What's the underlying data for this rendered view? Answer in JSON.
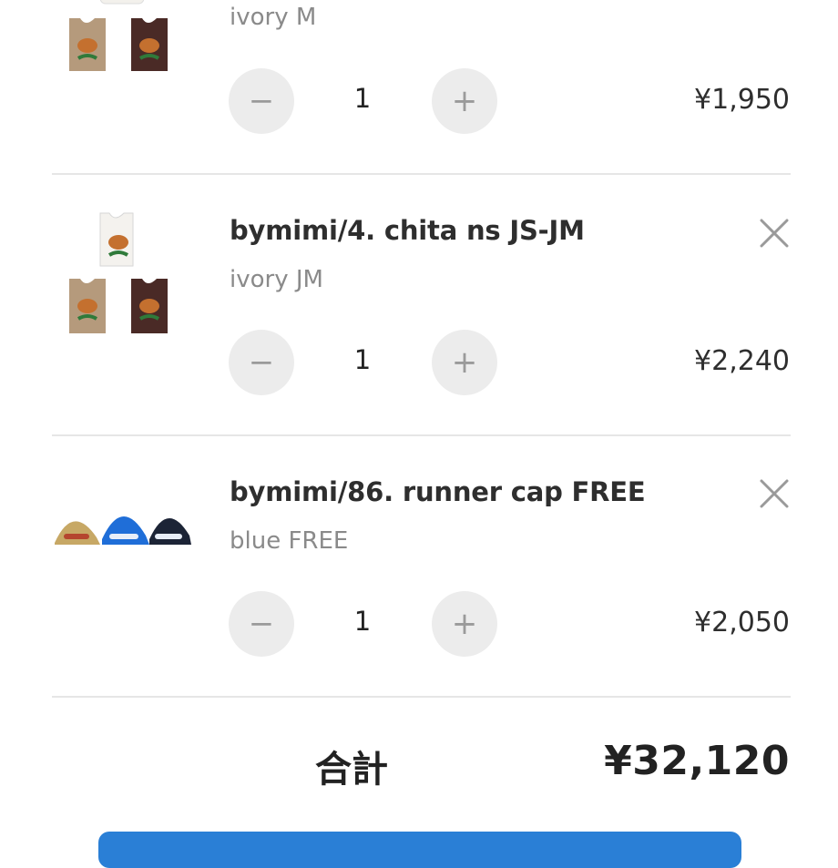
{
  "cart": {
    "items": [
      {
        "name": "",
        "variant": "ivory M",
        "quantity": "1",
        "price": "¥1,950",
        "minus_symbol": "−",
        "plus_symbol": "+",
        "thumbnail_icon": "tank-top-cheetah-thumbnail"
      },
      {
        "name": "bymimi/4. chita ns JS-JM",
        "variant": "ivory JM",
        "quantity": "1",
        "price": "¥2,240",
        "minus_symbol": "−",
        "plus_symbol": "+",
        "thumbnail_icon": "tank-top-cheetah-thumbnail"
      },
      {
        "name": "bymimi/86. runner cap FREE",
        "variant": "blue FREE",
        "quantity": "1",
        "price": "¥2,050",
        "minus_symbol": "−",
        "plus_symbol": "+",
        "thumbnail_icon": "caps-thumbnail"
      }
    ],
    "total_label": "合計",
    "total_value": "¥32,120"
  },
  "colors": {
    "accent": "#2a7fd6",
    "stepper_bg": "#ececec",
    "divider": "#e6e6e6",
    "variant_text": "#8a8a8a"
  }
}
